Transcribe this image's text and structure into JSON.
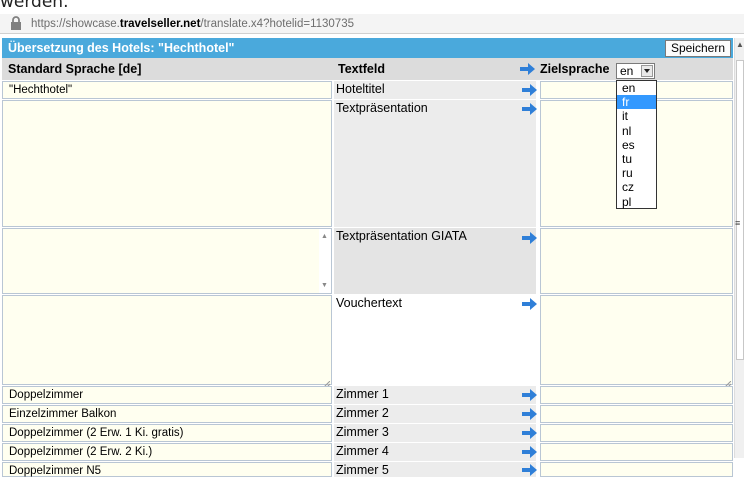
{
  "above_text": "werden.",
  "browser": {
    "url_prefix": "https://showcase.",
    "url_domain": "travelseller.net",
    "url_suffix": "/translate.x4?hotelid=1130735"
  },
  "window": {
    "title": "Übersetzung des Hotels: \"Hechthotel\"",
    "save_label": "Speichern"
  },
  "columns": {
    "source": "Standard Sprache [de]",
    "field": "Textfeld",
    "target": "Zielsprache"
  },
  "target_language": {
    "selected": "en",
    "options": [
      "en",
      "fr",
      "it",
      "nl",
      "es",
      "tu",
      "ru",
      "cz",
      "pl"
    ],
    "highlighted": "fr"
  },
  "rows": [
    {
      "source": "\"Hechthotel\"",
      "field": "Hoteltitel"
    },
    {
      "source": "",
      "field": "Textpräsentation"
    },
    {
      "source": "",
      "field": "Textpräsentation GIATA"
    },
    {
      "source": "",
      "field": "Vouchertext"
    },
    {
      "source": "Doppelzimmer",
      "field": "Zimmer 1"
    },
    {
      "source": "Einzelzimmer Balkon",
      "field": "Zimmer 2"
    },
    {
      "source": "Doppelzimmer (2 Erw. 1 Ki. gratis)",
      "field": "Zimmer 3"
    },
    {
      "source": "Doppelzimmer (2 Erw. 2 Ki.)",
      "field": "Zimmer 4"
    },
    {
      "source": "Doppelzimmer N5",
      "field": "Zimmer 5"
    }
  ],
  "icons": {
    "lock": "lock-icon",
    "arrow": "arrow-right-icon"
  },
  "colors": {
    "titlebar": "#4aa9dc",
    "cell_background": "#fffff0",
    "header_background": "#dcdcdc",
    "arrow": "#2f7fd8",
    "selected_option": "#3399ff"
  }
}
